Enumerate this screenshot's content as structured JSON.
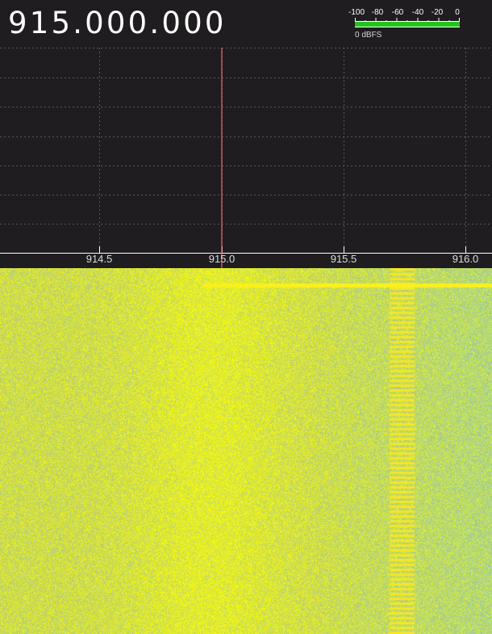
{
  "frequency_readout": "915.000.000",
  "signal_meter": {
    "scale_labels": [
      "-100",
      "-80",
      "-60",
      "-40",
      "-20",
      "0"
    ],
    "unit_label": "0 dBFS",
    "level_fraction": 1.0,
    "bar_color": "#22c41c"
  },
  "spectrum": {
    "background_color": "#1f1d1f",
    "grid_color": "#5a5a5a",
    "center_marker_color": "#e06060",
    "center_frequency_mhz": 915.0,
    "axis_tick_labels": [
      "914.5",
      "915.0",
      "915.5",
      "916.0"
    ],
    "axis_tick_values_mhz": [
      914.5,
      915.0,
      915.5,
      916.0
    ]
  },
  "waterfall": {
    "base_color": "#d2e040",
    "bright_color": "#f2f020",
    "noise_color": "#b5c8a0"
  }
}
